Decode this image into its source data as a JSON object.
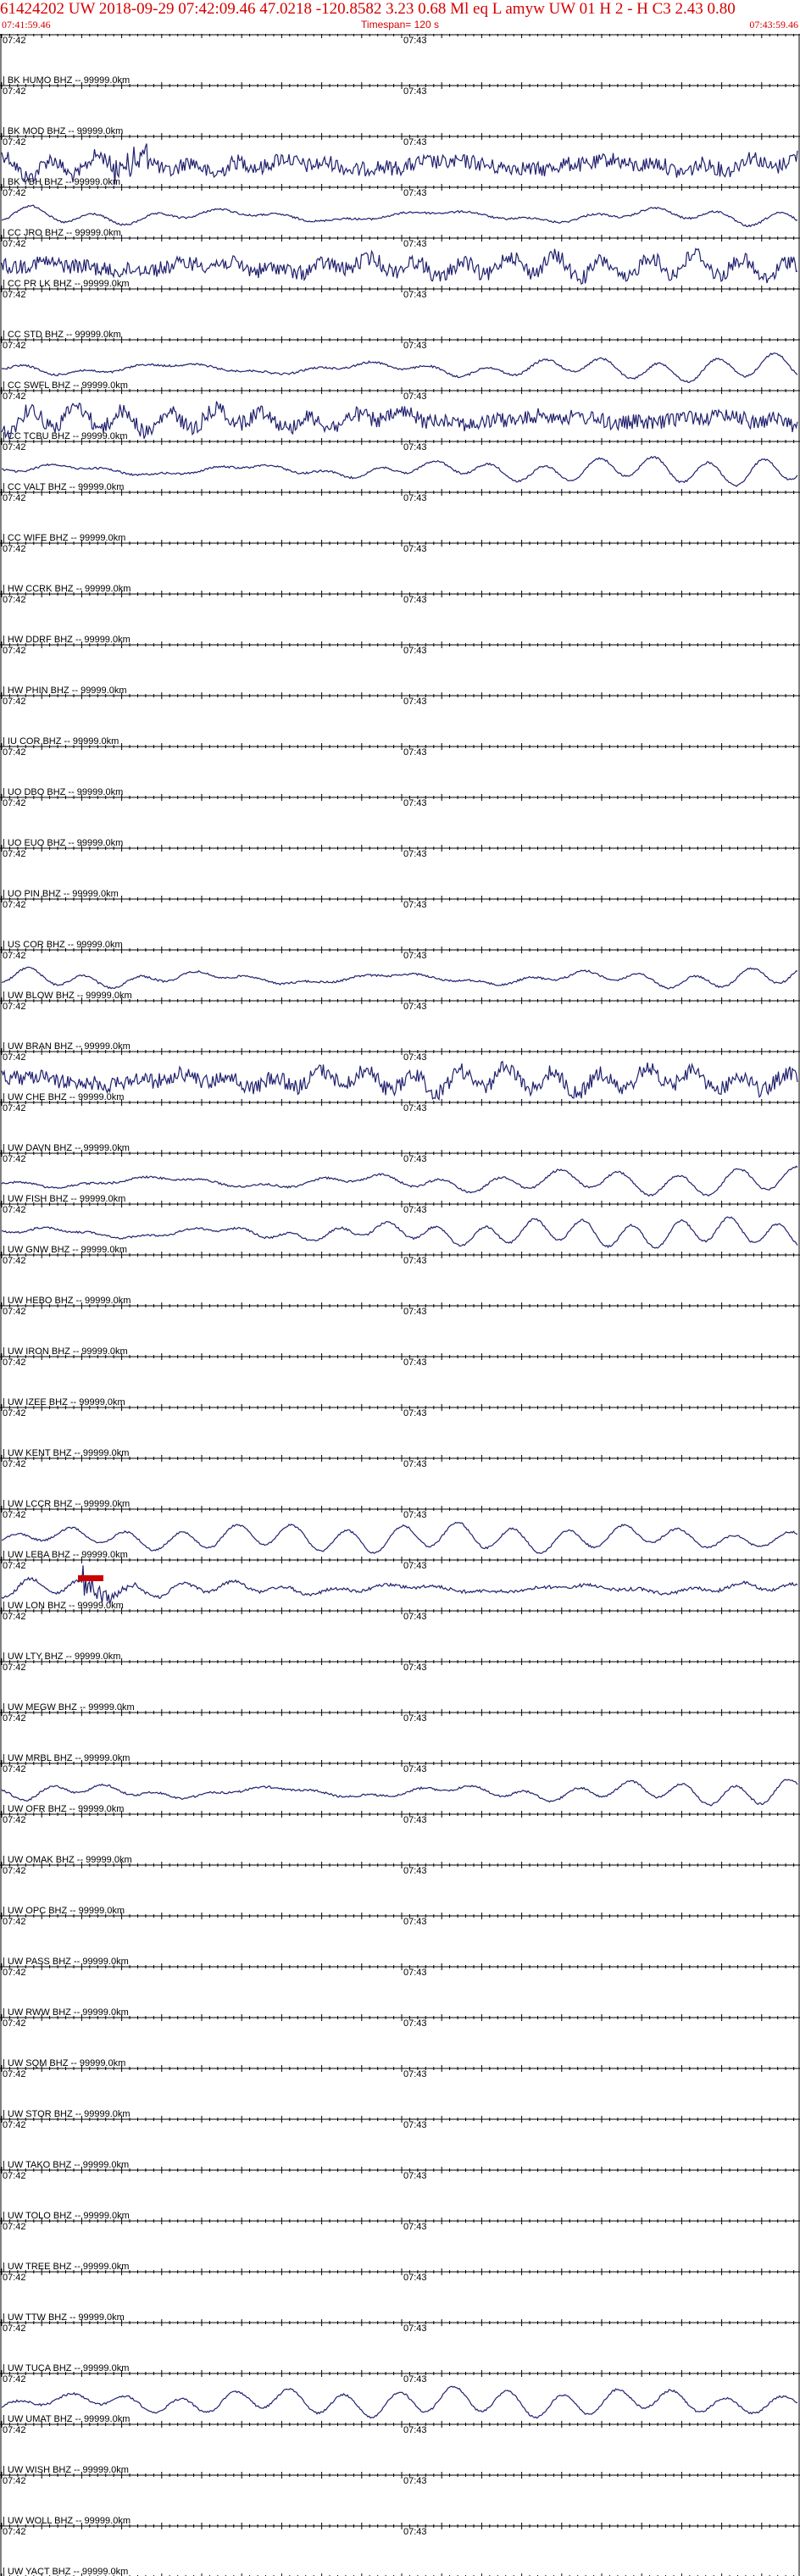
{
  "header": {
    "title": "61424202 UW 2018-09-29 07:42:09.46   47.0218  -120.8582   3.23  0.68 Ml  eq  L  amyw      UW 01  H   2   -  H C3     2.43  0.80",
    "start_time": "07:41:59.46",
    "timespan": "Timespan= 120 s",
    "end_time": "07:43:59.46"
  },
  "chart_data": {
    "type": "line",
    "title": "61424202 UW 2018-09-29 07:42:09.46",
    "xlabel": "",
    "ylabel": "",
    "x_range": [
      "07:41:59.46",
      "07:43:59.46"
    ],
    "tick_labels": [
      "07:42",
      "07:43"
    ],
    "pick_marker_color": "#cc0000",
    "trace_color": "#20206e",
    "channels": [
      {
        "label": "| BK HUMO BHZ -- 99999.0km",
        "signal": "none"
      },
      {
        "label": "| BK MOD BHZ -- 99999.0km",
        "signal": "none"
      },
      {
        "label": "| BK YBH BHZ -- 99999.0km",
        "signal": "noisy"
      },
      {
        "label": "| CC JRO BHZ -- 99999.0km",
        "signal": "wave"
      },
      {
        "label": "| CC PR LK BHZ -- 99999.0km",
        "signal": "noisy"
      },
      {
        "label": "| CC STD BHZ -- 99999.0km",
        "signal": "none"
      },
      {
        "label": "| CC SWFL BHZ -- 99999.0km",
        "signal": "wave"
      },
      {
        "label": "| CC TCBU BHZ -- 99999.0km",
        "signal": "noisy"
      },
      {
        "label": "| CC VALT BHZ -- 99999.0km",
        "signal": "wave"
      },
      {
        "label": "| CC WIFE BHZ -- 99999.0km",
        "signal": "none"
      },
      {
        "label": "| HW CCRK BHZ -- 99999.0km",
        "signal": "none"
      },
      {
        "label": "| HW DDRF BHZ -- 99999.0km",
        "signal": "none"
      },
      {
        "label": "| HW PHIN BHZ -- 99999.0km",
        "signal": "none"
      },
      {
        "label": "| IU COR BHZ -- 99999.0km",
        "signal": "none"
      },
      {
        "label": "| UO DBO BHZ -- 99999.0km",
        "signal": "none"
      },
      {
        "label": "| UO EUO BHZ -- 99999.0km",
        "signal": "none"
      },
      {
        "label": "| UO PIN BHZ -- 99999.0km",
        "signal": "none"
      },
      {
        "label": "| US COR BHZ -- 99999.0km",
        "signal": "none"
      },
      {
        "label": "| UW BLOW BHZ -- 99999.0km",
        "signal": "wave"
      },
      {
        "label": "| UW BRAN BHZ -- 99999.0km",
        "signal": "none"
      },
      {
        "label": "| UW CHE BHZ -- 99999.0km",
        "signal": "noisy"
      },
      {
        "label": "| UW DAVN BHZ -- 99999.0km",
        "signal": "none"
      },
      {
        "label": "| UW FISH BHZ -- 99999.0km",
        "signal": "wave"
      },
      {
        "label": "| UW GNW BHZ -- 99999.0km",
        "signal": "wave"
      },
      {
        "label": "| UW HEBO BHZ -- 99999.0km",
        "signal": "none"
      },
      {
        "label": "| UW IRON BHZ -- 99999.0km",
        "signal": "none"
      },
      {
        "label": "| UW IZEE BHZ -- 99999.0km",
        "signal": "none"
      },
      {
        "label": "| UW KENT BHZ -- 99999.0km",
        "signal": "none"
      },
      {
        "label": "| UW LCCR BHZ -- 99999.0km",
        "signal": "none"
      },
      {
        "label": "| UW LEBA BHZ -- 99999.0km",
        "signal": "wave"
      },
      {
        "label": "| UW LON BHZ -- 99999.0km",
        "signal": "event"
      },
      {
        "label": "| UW LTY BHZ -- 99999.0km",
        "signal": "none"
      },
      {
        "label": "| UW MEGW BHZ -- 99999.0km",
        "signal": "none"
      },
      {
        "label": "| UW MRBL BHZ -- 99999.0km",
        "signal": "none"
      },
      {
        "label": "| UW OFR BHZ -- 99999.0km",
        "signal": "wave"
      },
      {
        "label": "| UW OMAK BHZ -- 99999.0km",
        "signal": "none"
      },
      {
        "label": "| UW OPC BHZ -- 99999.0km",
        "signal": "none"
      },
      {
        "label": "| UW PASS BHZ -- 99999.0km",
        "signal": "none"
      },
      {
        "label": "| UW RWW BHZ -- 99999.0km",
        "signal": "none"
      },
      {
        "label": "| UW SQM BHZ -- 99999.0km",
        "signal": "none"
      },
      {
        "label": "| UW STOR BHZ -- 99999.0km",
        "signal": "none"
      },
      {
        "label": "| UW TAKO BHZ -- 99999.0km",
        "signal": "none"
      },
      {
        "label": "| UW TOLO BHZ -- 99999.0km",
        "signal": "none"
      },
      {
        "label": "| UW TREE BHZ -- 99999.0km",
        "signal": "none"
      },
      {
        "label": "| UW TTW BHZ -- 99999.0km",
        "signal": "none"
      },
      {
        "label": "| UW TUCA BHZ -- 99999.0km",
        "signal": "none"
      },
      {
        "label": "| UW UMAT BHZ -- 99999.0km",
        "signal": "wave"
      },
      {
        "label": "| UW WISH BHZ -- 99999.0km",
        "signal": "none"
      },
      {
        "label": "| UW WOLL BHZ -- 99999.0km",
        "signal": "none"
      },
      {
        "label": "| UW YACT BHZ -- 99999.0km",
        "signal": "none"
      }
    ]
  }
}
